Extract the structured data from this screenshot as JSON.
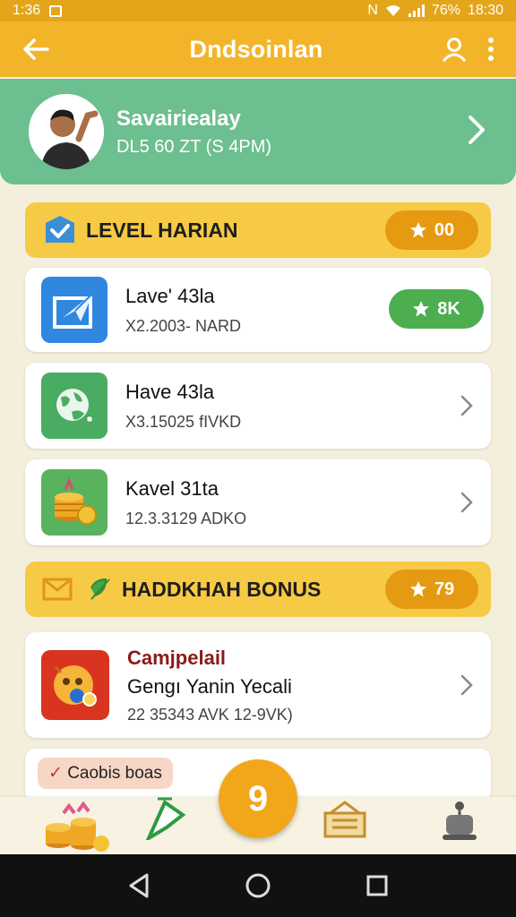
{
  "status_bar": {
    "time_left": "1:36",
    "network": "N",
    "battery": "76%",
    "time_right": "18:30"
  },
  "app_bar": {
    "title": "Dndsoinlan"
  },
  "profile": {
    "name": "Savairiealay",
    "subtitle": "DL5 60 ZT (S 4PM)"
  },
  "daily_section": {
    "title": "LEVEL HARIAN",
    "badge": "00"
  },
  "daily_items": [
    {
      "name": "Lave' 43la",
      "meta": "X2.2003- NARD",
      "badge": "8K"
    },
    {
      "name": "Have 43la",
      "meta": "X3.15025 fIVKD"
    },
    {
      "name": "Kavel 31ta",
      "meta": "12.3.3129 ADKO"
    }
  ],
  "bonus_section": {
    "title": "HADDKHAH BONUS",
    "badge": "79"
  },
  "bonus_items": [
    {
      "name": "Camjpelail",
      "name2": "Gengı Yanin Yecali",
      "meta": "22 35343 AVK  12-9VK)"
    }
  ],
  "partial_card": {
    "tag": "Caobis boas"
  },
  "bottom_nav": {
    "center": "9"
  },
  "colors": {
    "primary": "#f2b52a",
    "green": "#6cbf8e",
    "section": "#f6ca45",
    "badge": "#e59a12",
    "ok": "#4cae4f"
  }
}
